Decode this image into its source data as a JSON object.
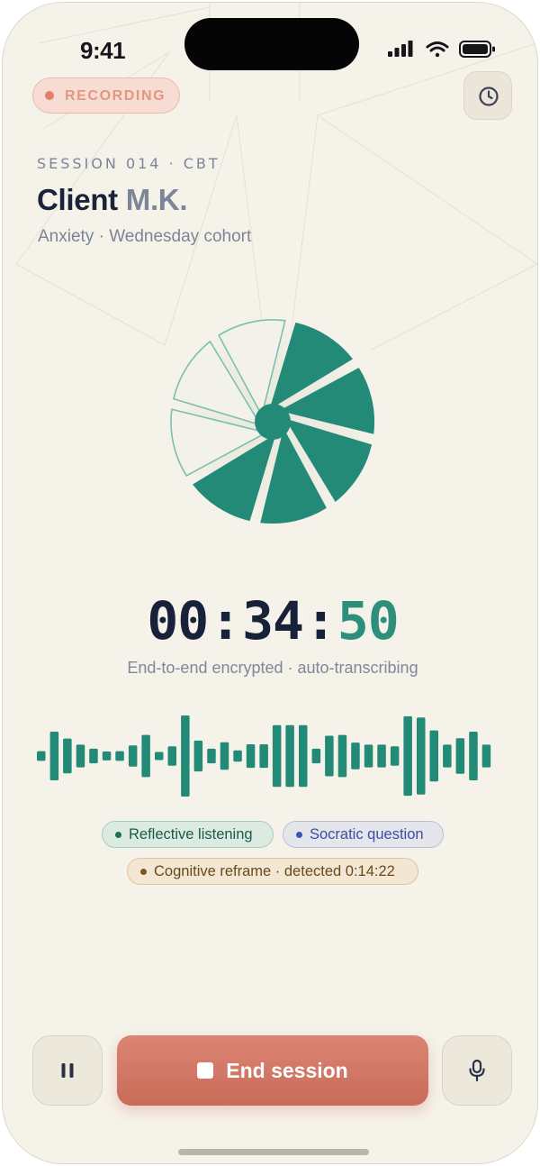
{
  "status_bar": {
    "time": "9:41",
    "icons": [
      "cellular-signal-icon",
      "wifi-icon",
      "battery-icon"
    ]
  },
  "header": {
    "recording_label": "RECORDING",
    "history_icon": "clock-icon"
  },
  "session": {
    "label": "SESSION 014 · CBT",
    "client_prefix": "Client",
    "client_initials": "M.K.",
    "subtitle": "Anxiety · Wednesday cohort"
  },
  "progress": {
    "icon": "session-progress-wheel",
    "segments_total": 8,
    "segments_filled": 5
  },
  "timer": {
    "hours": "00",
    "minutes": "34",
    "seconds": "50",
    "separator": ":",
    "subtitle": "End-to-end encrypted · auto-transcribing"
  },
  "waveform": {
    "levels": [
      0.12,
      0.6,
      0.43,
      0.28,
      0.18,
      0.11,
      0.12,
      0.26,
      0.52,
      0.1,
      0.24,
      1.0,
      0.38,
      0.18,
      0.34,
      0.14,
      0.29,
      0.29,
      0.76,
      0.76,
      0.76,
      0.18,
      0.5,
      0.52,
      0.33,
      0.28,
      0.28,
      0.24,
      0.98,
      0.95,
      0.63,
      0.28,
      0.44,
      0.6,
      0.28
    ]
  },
  "tags": {
    "reflective": "Reflective listening",
    "socratic": "Socratic question",
    "reframe": "Cognitive reframe · detected 0:14:22"
  },
  "controls": {
    "pause_icon": "pause-icon",
    "end_label": "End session",
    "stop_icon": "stop-icon",
    "mic_icon": "microphone-icon"
  },
  "colors": {
    "background": "#f5f2ea",
    "accent_teal": "#238a77",
    "recording": "#e2806a",
    "end_button": "#d47a67",
    "ink": "#1a2338"
  }
}
